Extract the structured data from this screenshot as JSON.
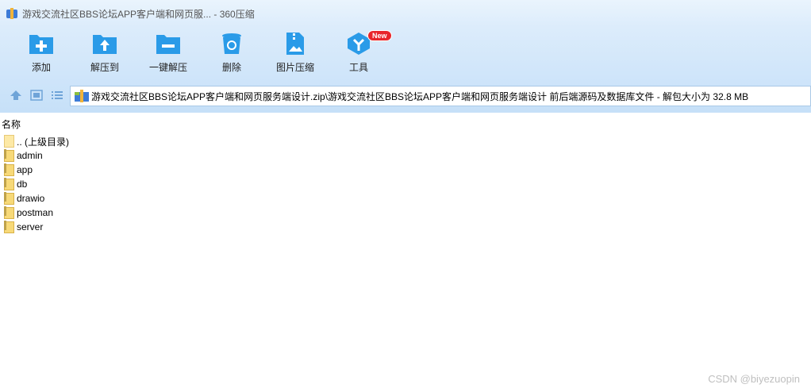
{
  "window": {
    "title": "游戏交流社区BBS论坛APP客户端和网页服... - 360压缩"
  },
  "toolbar": {
    "items": [
      {
        "label": "添加",
        "icon": "add-icon"
      },
      {
        "label": "解压到",
        "icon": "extract-to-icon"
      },
      {
        "label": "一键解压",
        "icon": "one-click-extract-icon"
      },
      {
        "label": "删除",
        "icon": "delete-icon"
      },
      {
        "label": "图片压缩",
        "icon": "image-compress-icon"
      },
      {
        "label": "工具",
        "icon": "tools-icon",
        "badge": "New"
      }
    ]
  },
  "address": {
    "path": "游戏交流社区BBS论坛APP客户端和网页服务端设计.zip\\游戏交流社区BBS论坛APP客户端和网页服务端设计 前后端源码及数据库文件 - 解包大小为 32.8 MB"
  },
  "list": {
    "column_name": "名称",
    "rows": [
      {
        "name": ".. (上级目录)",
        "type": "parent"
      },
      {
        "name": "admin",
        "type": "folder"
      },
      {
        "name": "app",
        "type": "folder"
      },
      {
        "name": "db",
        "type": "folder"
      },
      {
        "name": "drawio",
        "type": "folder"
      },
      {
        "name": "postman",
        "type": "folder"
      },
      {
        "name": "server",
        "type": "folder"
      }
    ]
  },
  "watermark": "CSDN @biyezuopin",
  "colors": {
    "accent": "#2a9be8",
    "toolbar_bg": "#d5e9fb",
    "badge": "#e8262b",
    "folder": "#f7d978"
  }
}
